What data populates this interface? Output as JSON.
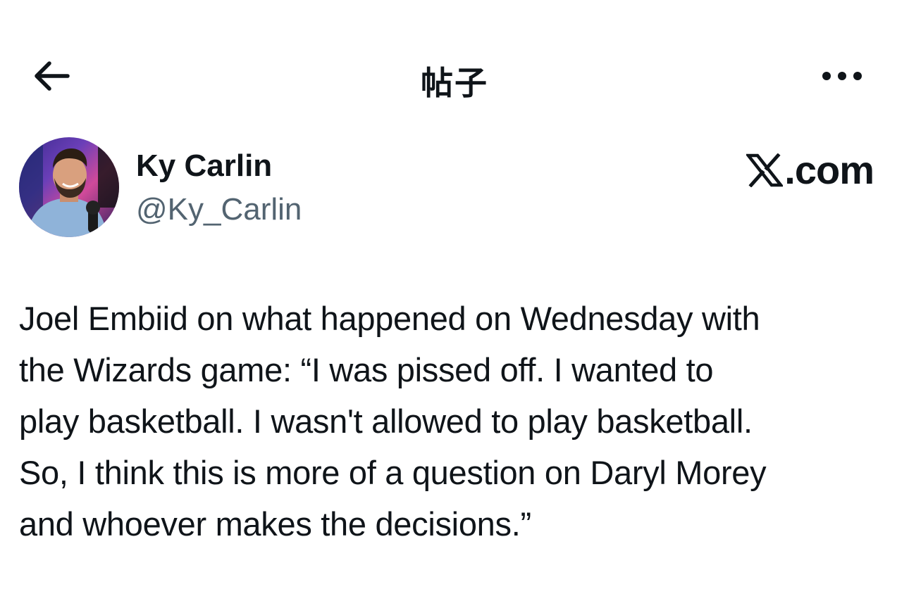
{
  "nav": {
    "title": "帖子",
    "back_icon": "arrow-left-icon",
    "more_icon": "more-horizontal-icon"
  },
  "author": {
    "name": "Ky Carlin",
    "handle": "@Ky_Carlin",
    "avatar_icon": "user-avatar"
  },
  "site": {
    "label": ".com",
    "logo_icon": "x-logo-icon"
  },
  "tweet": {
    "text": "Joel Embiid on what happened on Wednesday with\nthe Wizards game: “I was pissed off. I wanted to\nplay basketball. I wasn't allowed to play basketball.\nSo, I think this is more of a question on Daryl Morey\nand whoever makes the decisions.”"
  },
  "colors": {
    "text_primary": "#0f1419",
    "text_secondary": "#536471",
    "background": "#ffffff"
  }
}
